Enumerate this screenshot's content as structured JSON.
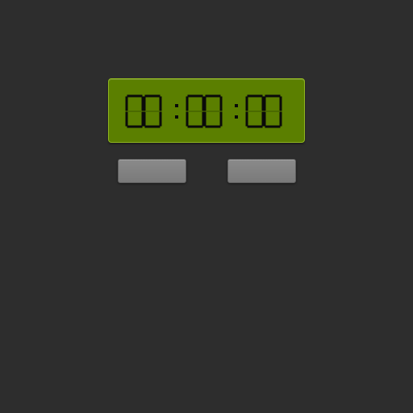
{
  "timer": {
    "display": "00:00:00",
    "hours": "00",
    "minutes": "00",
    "seconds": "00"
  },
  "controls": {
    "left_button_label": "",
    "right_button_label": ""
  },
  "colors": {
    "background": "#2d2d2d",
    "lcd_background": "#5b7f00",
    "lcd_border": "#8fb520",
    "digit": "#0a0a0a",
    "button": "#808080"
  }
}
